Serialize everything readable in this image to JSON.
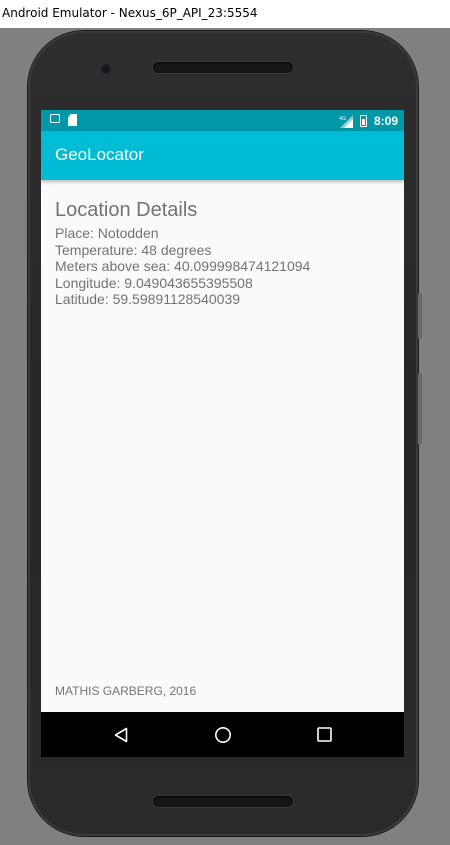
{
  "window": {
    "title": "Android Emulator - Nexus_6P_API_23:5554"
  },
  "statusbar": {
    "left_icons": [
      "message-icon",
      "sd-card-icon"
    ],
    "right_icons": [
      "signal-4g-icon",
      "battery-icon"
    ],
    "network_label": "4G",
    "time": "8:09"
  },
  "appbar": {
    "title": "GeoLocator"
  },
  "location": {
    "heading": "Location Details",
    "lines": [
      "Place: Notodden",
      "Temperature: 48 degrees",
      "Meters above sea: 40.099998474121094",
      "Longitude: 9.049043655395508",
      "Latitude: 59.59891128540039"
    ]
  },
  "footer": {
    "credit": "MATHIS GARBERG, 2016"
  },
  "navbar": {
    "buttons": [
      "back-icon",
      "home-icon",
      "recents-icon"
    ]
  },
  "colors": {
    "statusbar": "#0097a7",
    "appbar": "#00bcd4",
    "screen_bg": "#fafafa",
    "text": "#737373",
    "emulator_bg": "#808080"
  }
}
